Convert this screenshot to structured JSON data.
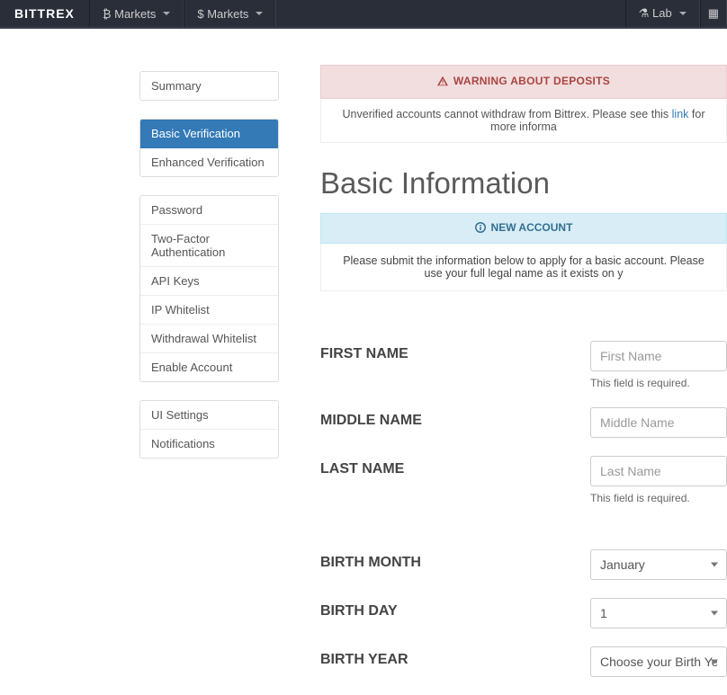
{
  "nav": {
    "brand": "BITTREX",
    "markets_btc": "₿ Markets",
    "markets_usd": "$ Markets",
    "lab": "⚗ Lab"
  },
  "sidebar": {
    "group1": [
      {
        "label": "Summary"
      }
    ],
    "group2": [
      {
        "label": "Basic Verification",
        "active": true
      },
      {
        "label": "Enhanced Verification"
      }
    ],
    "group3": [
      {
        "label": "Password"
      },
      {
        "label": "Two-Factor Authentication"
      },
      {
        "label": "API Keys"
      },
      {
        "label": "IP Whitelist"
      },
      {
        "label": "Withdrawal Whitelist"
      },
      {
        "label": "Enable Account"
      }
    ],
    "group4": [
      {
        "label": "UI Settings"
      },
      {
        "label": "Notifications"
      }
    ]
  },
  "alert": {
    "title": "WARNING ABOUT DEPOSITS",
    "desc_prefix": "Unverified accounts cannot withdraw from Bittrex. Please see this ",
    "link_label": "link",
    "desc_suffix": " for more informa"
  },
  "page": {
    "title": "Basic Information"
  },
  "info_box": {
    "title": "NEW ACCOUNT",
    "body": "Please submit the information below to apply for a basic account. Please use your full legal name as it exists on y"
  },
  "form": {
    "first_name": {
      "label": "FIRST NAME",
      "placeholder": "First Name",
      "help": "This field is required."
    },
    "middle_name": {
      "label": "MIDDLE NAME",
      "placeholder": "Middle Name"
    },
    "last_name": {
      "label": "LAST NAME",
      "placeholder": "Last Name",
      "help": "This field is required."
    },
    "birth_month": {
      "label": "BIRTH MONTH",
      "value": "January"
    },
    "birth_day": {
      "label": "BIRTH DAY",
      "value": "1"
    },
    "birth_year": {
      "label": "BIRTH YEAR",
      "value": "Choose your Birth Year ..."
    }
  }
}
